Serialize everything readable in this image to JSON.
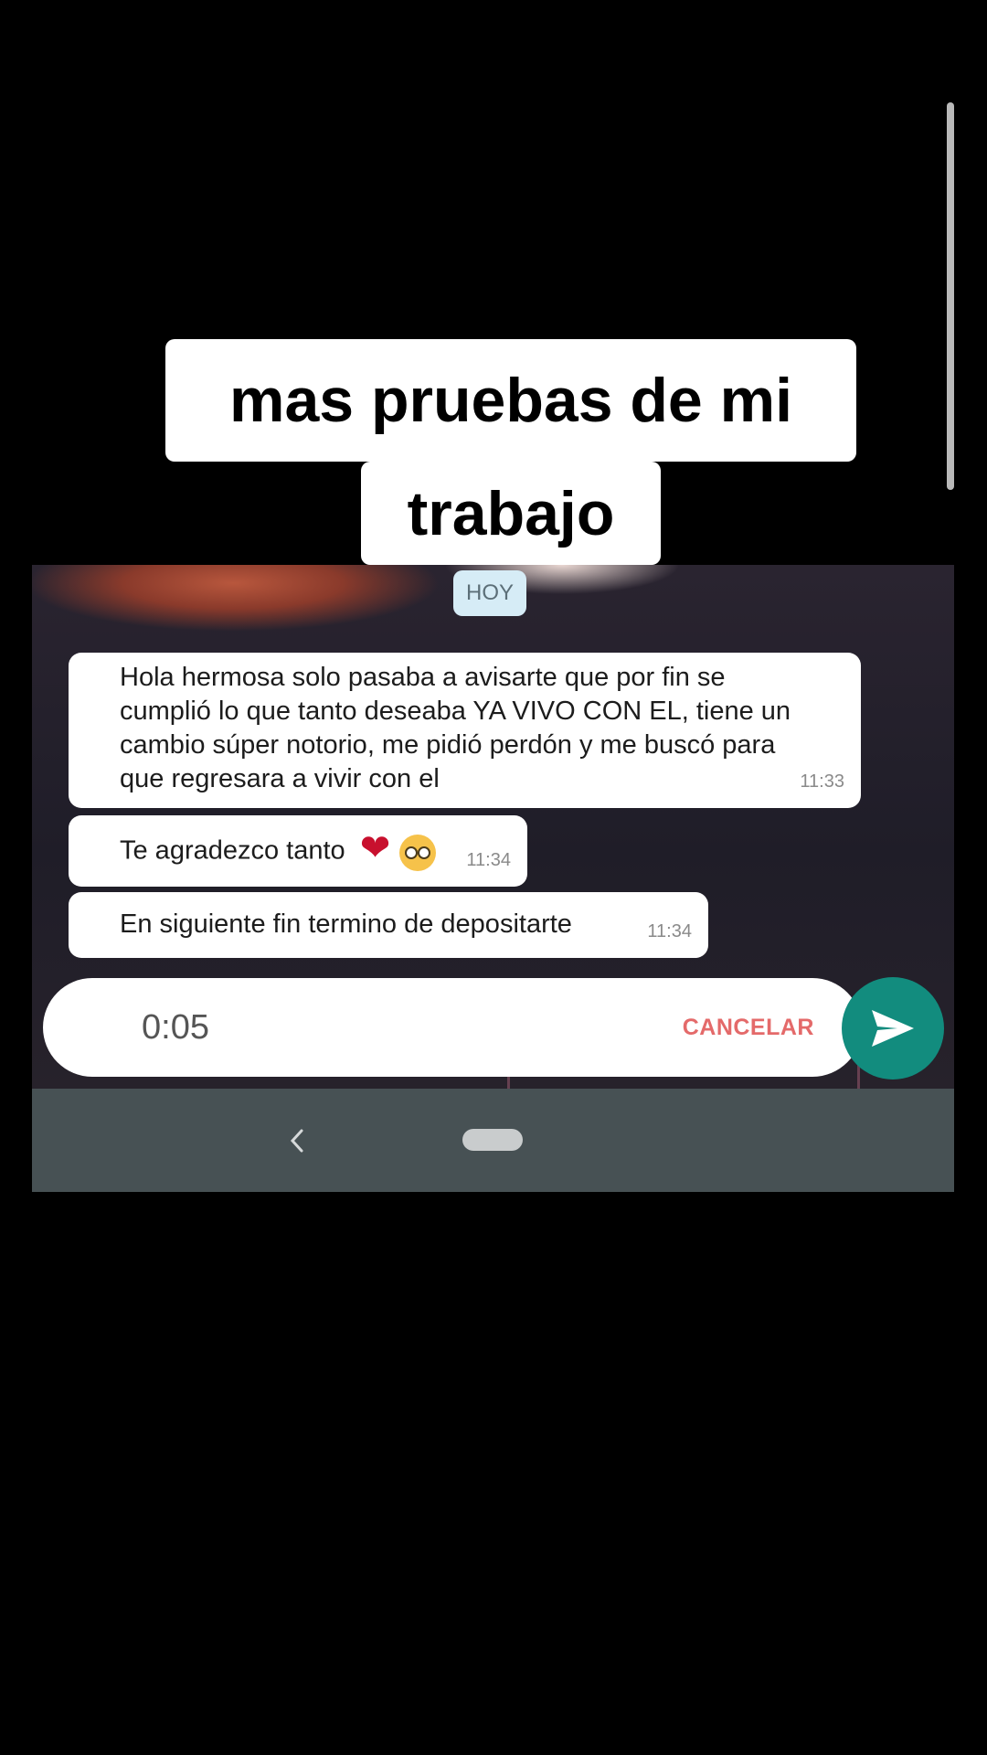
{
  "caption": {
    "line1": "mas pruebas de mi",
    "line2": "trabajo"
  },
  "chat": {
    "date_chip": "HOY",
    "messages": [
      {
        "lines": [
          "Hola hermosa solo pasaba a avisarte que por fin se",
          "cumplió lo que tanto deseaba YA VIVO CON EL, tiene un",
          "cambio súper notorio, me pidió perdón y me buscó para",
          "que regresara a vivir con el"
        ],
        "time": "11:33"
      },
      {
        "text": "Te agradezco tanto",
        "emojis": [
          "heart-emoji",
          "pleading-face-emoji"
        ],
        "time": "11:34"
      },
      {
        "text": "En siguiente fin termino de depositarte",
        "time": "11:34"
      }
    ]
  },
  "composer": {
    "recording_timer": "0:05",
    "cancel_label": "CANCELAR",
    "send_icon": "send-icon"
  },
  "navbar": {
    "back_icon": "back-chevron-icon",
    "home_icon": "home-pill-icon"
  },
  "colors": {
    "send_button": "#128c7e",
    "cancel_text": "#e46a6a",
    "navbar": "#475154",
    "date_chip": "#d6ecf6"
  }
}
